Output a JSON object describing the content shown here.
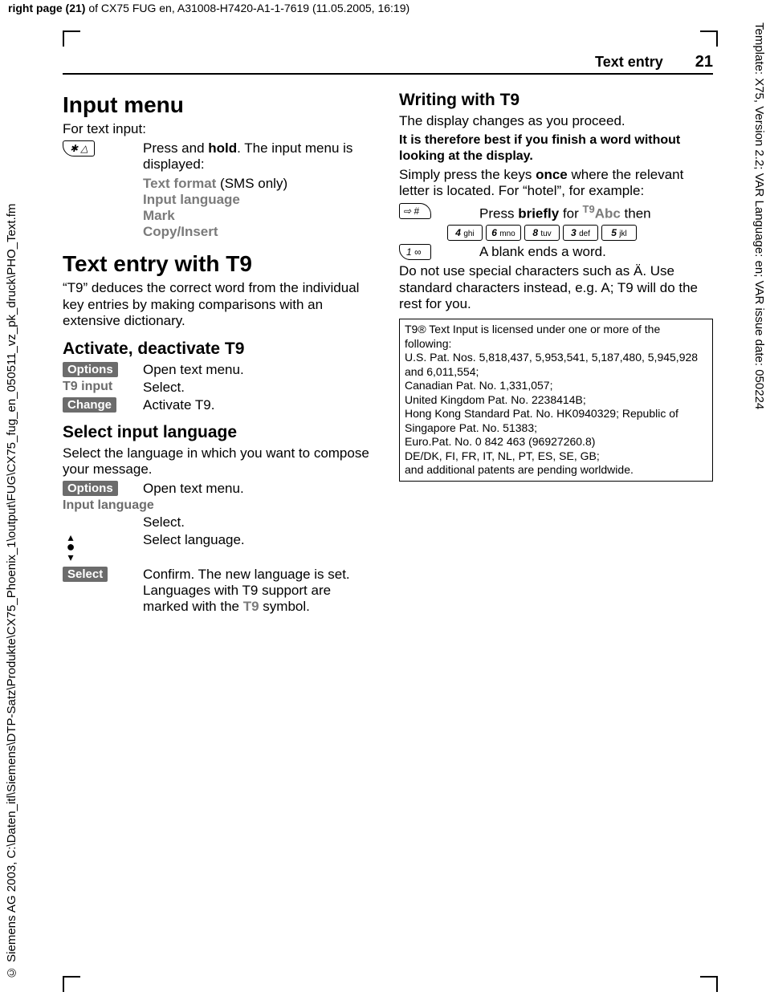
{
  "meta": {
    "top_prefix": "right page (21)",
    "top_rest": " of CX75 FUG en, A31008-H7420-A1-1-7619 (11.05.2005, 16:19)",
    "right_vert": "Template: X75, Version 2.2; VAR Language: en; VAR issue date: 050224",
    "left_vert": "© Siemens AG 2003, C:\\Daten_itl\\Siemens\\DTP-Satz\\Produkte\\CX75_Phoenix_1\\output\\FUG\\CX75_fug_en_050511_vz_pk_druck\\PHO_Text.fm"
  },
  "header": {
    "section": "Text entry",
    "page": "21"
  },
  "left": {
    "h1a": "Input menu",
    "intro": "For text input:",
    "starKey": "✱ △",
    "pressHold_a": "Press and ",
    "pressHold_b": "hold",
    "pressHold_c": ". The input menu is displayed:",
    "menu1": "Text format",
    "menu1_suffix": " (SMS only)",
    "menu2": "Input language",
    "menu3": "Mark",
    "menu4": "Copy/Insert",
    "h1b": "Text entry with T9",
    "t9para": "“T9” deduces the correct word from the individual key entries by making comparisons with an extensive dictionary.",
    "h2a": "Activate, deactivate T9",
    "opt_label": "Options",
    "opt_text": "Open text menu.",
    "t9input_label": "T9 input",
    "t9input_text": "Select.",
    "change_label": "Change",
    "change_text": "Activate T9.",
    "h2b": "Select input language",
    "sel_para": "Select the language in which you want to compose your message.",
    "opt2_text": "Open text menu.",
    "inputlang_label": "Input language",
    "inputlang_text": "Select.",
    "joy_text": "Select language.",
    "select_label": "Select",
    "select_text_a": "Confirm. The new language is set. Languages with T9 support are marked with the ",
    "select_text_b": "T9",
    "select_text_c": " symbol."
  },
  "right": {
    "h2": "Writing with T9",
    "p1": "The display changes as you proceed.",
    "bold1": "It is therefore best if you finish a word without looking at the display.",
    "p2a": "Simply press the keys ",
    "p2b": "once",
    "p2c": " where the relevant letter is located. For “hotel”, for example:",
    "hashKey": "⇨ #",
    "briefly_a": "Press ",
    "briefly_b": "briefly",
    "briefly_c": " for ",
    "briefly_d": "T9",
    "briefly_e": "Abc",
    "briefly_f": " then",
    "keys": [
      {
        "n": "4",
        "l": "ghi"
      },
      {
        "n": "6",
        "l": "mno"
      },
      {
        "n": "8",
        "l": "tuv"
      },
      {
        "n": "3",
        "l": "def"
      },
      {
        "n": "5",
        "l": "jkl"
      }
    ],
    "key1": "1  ∞",
    "blank": "A blank ends a word.",
    "p3": "Do not use special characters such as Ä. Use standard characters instead, e.g. A; T9 will do the rest for you.",
    "patent": "T9® Text Input is licensed under one or more of the following:\nU.S. Pat. Nos. 5,818,437, 5,953,541, 5,187,480, 5,945,928 and 6,011,554;\nCanadian Pat. No. 1,331,057;\nUnited Kingdom Pat. No. 2238414B;\nHong Kong Standard Pat. No. HK0940329; Republic of Singapore Pat. No. 51383;\nEuro.Pat. No. 0 842 463 (96927260.8)\nDE/DK, FI, FR, IT, NL, PT, ES, SE, GB;\nand additional patents are pending worldwide."
  }
}
